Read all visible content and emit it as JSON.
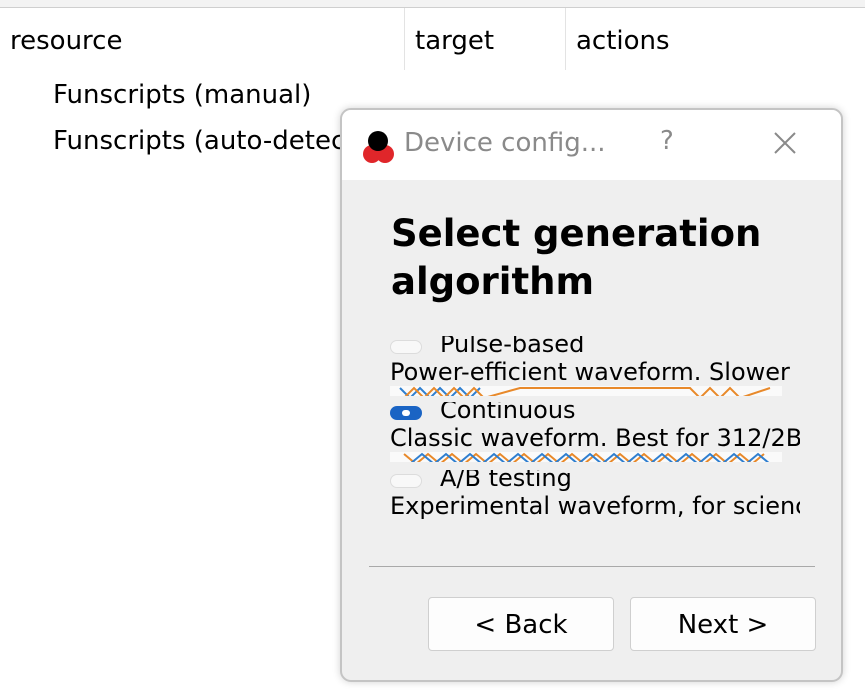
{
  "table": {
    "headers": [
      "resource",
      "target",
      "actions"
    ],
    "items": [
      "Funscripts (manual)",
      "Funscripts (auto-detected)"
    ]
  },
  "dialog": {
    "title": "Device config...",
    "help": "?",
    "heading": "Select generation algorithm",
    "options": [
      {
        "name": "Pulse-based",
        "description": "Power-efficient waveform. Slower",
        "checked": false
      },
      {
        "name": "Continuous",
        "description": "Classic waveform. Best for 312/2B",
        "checked": true
      },
      {
        "name": "A/B testing",
        "description": "Experimental waveform, for scienc",
        "checked": false
      }
    ],
    "back_label": "< Back",
    "next_label": "Next >"
  },
  "colors": {
    "accent": "#1a64c4",
    "wave_orange": "#e8892a",
    "wave_blue": "#2f7fd0",
    "icon_red": "#e0262a"
  }
}
